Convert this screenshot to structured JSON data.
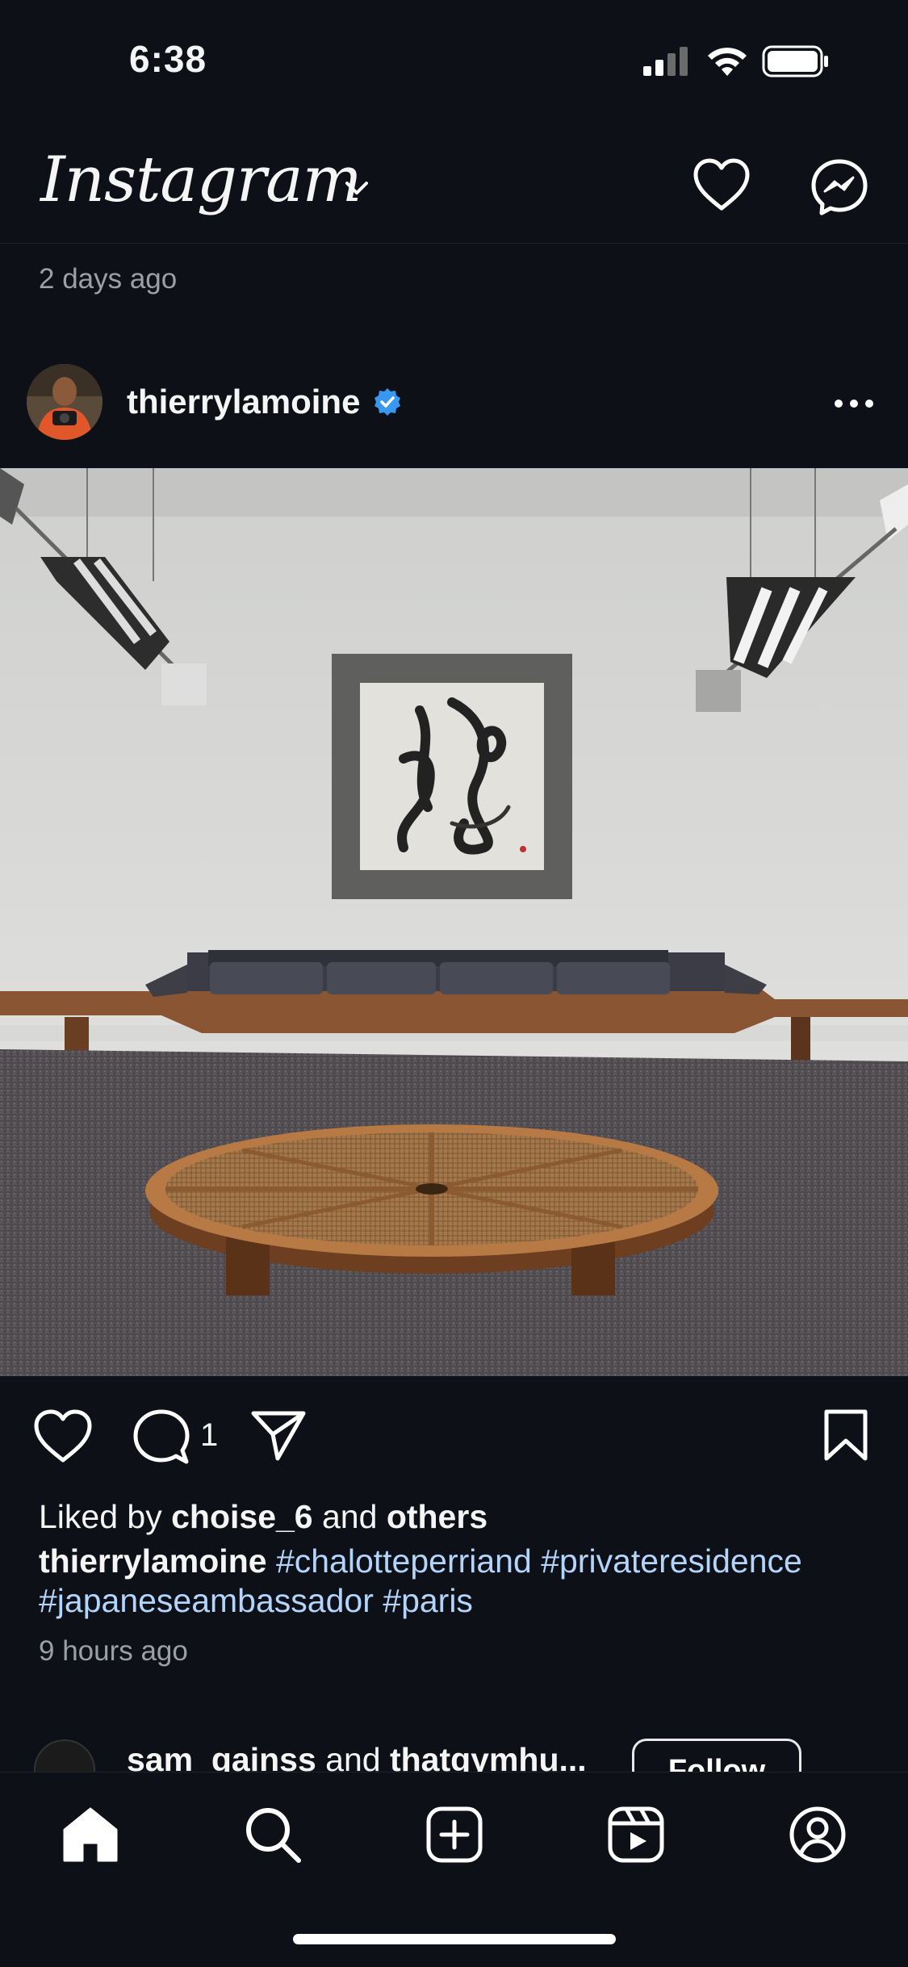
{
  "status_bar": {
    "time": "6:38"
  },
  "header": {
    "logo": "Instagram"
  },
  "previous_post": {
    "time": "2 days ago"
  },
  "post": {
    "username": "thierrylamoine",
    "comment_count": "1",
    "liked_by_prefix": "Liked by ",
    "liked_by_user": "choise_6",
    "liked_by_and": " and ",
    "liked_by_others": "others",
    "caption_user": "thierrylamoine",
    "hashtags": [
      "#chalotteperriand",
      "#privateresidence",
      "#japaneseambassador",
      "#paris"
    ],
    "time": "9 hours ago"
  },
  "suggested": {
    "user1": "sam_gainss",
    "and": " and ",
    "user2": "thatgymhu...",
    "follow_label": "Follow"
  },
  "icons": {
    "header": [
      "chevron-down-icon",
      "heart-icon",
      "messenger-icon"
    ],
    "actions": [
      "heart-icon",
      "comment-icon",
      "share-icon",
      "bookmark-icon"
    ],
    "nav": [
      "home-icon",
      "search-icon",
      "create-icon",
      "reels-icon",
      "profile-icon"
    ]
  },
  "colors": {
    "background": "#0d1117",
    "hashtag": "#b3d4fb",
    "verified": "#3897f0"
  }
}
